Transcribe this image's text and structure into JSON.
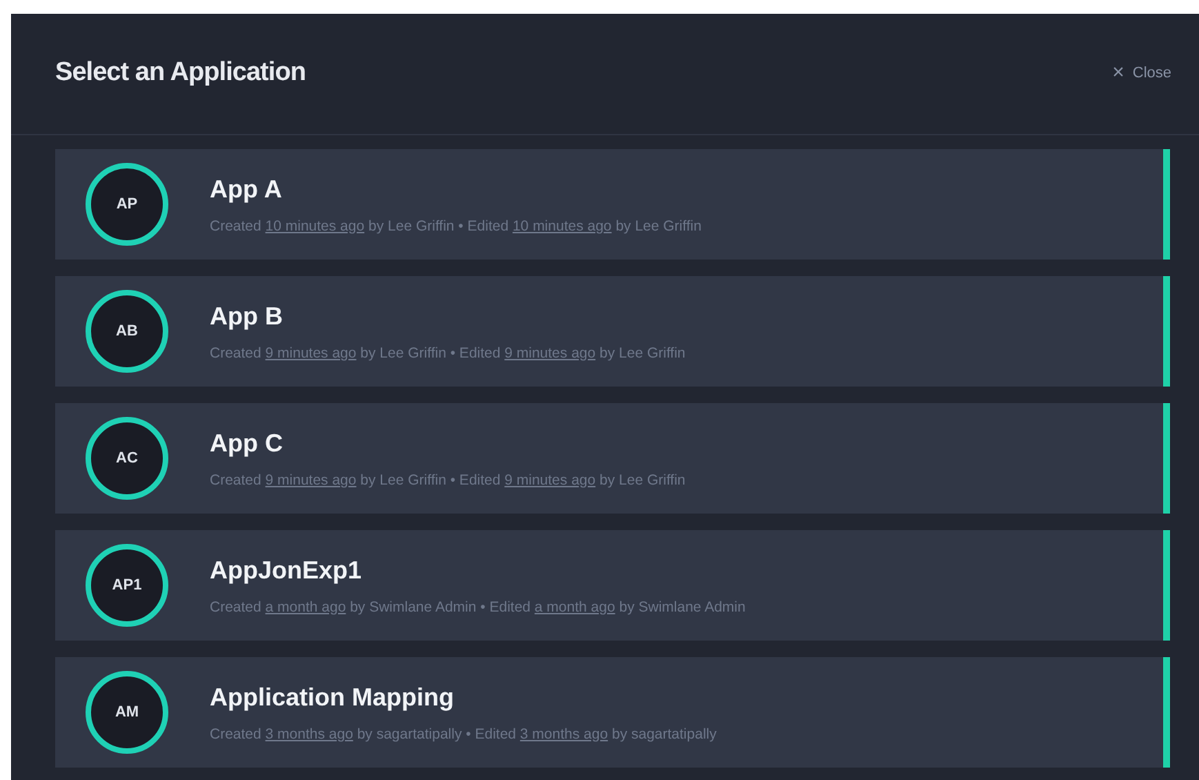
{
  "dialog": {
    "title": "Select an Application",
    "close": {
      "icon": "×",
      "label": "Close"
    }
  },
  "applications": [
    {
      "initials": "AP",
      "name": "App A",
      "meta": [
        {
          "kind": "plain",
          "text": "Created "
        },
        {
          "kind": "link",
          "text": "10 minutes ago"
        },
        {
          "kind": "plain",
          "text": " by Lee Griffin • Edited "
        },
        {
          "kind": "link",
          "text": "10 minutes ago"
        },
        {
          "kind": "plain",
          "text": " by Lee Griffin"
        }
      ]
    },
    {
      "initials": "AB",
      "name": "App B",
      "meta": [
        {
          "kind": "plain",
          "text": "Created "
        },
        {
          "kind": "link",
          "text": "9 minutes ago"
        },
        {
          "kind": "plain",
          "text": " by Lee Griffin • Edited "
        },
        {
          "kind": "link",
          "text": "9 minutes ago"
        },
        {
          "kind": "plain",
          "text": " by Lee Griffin"
        }
      ]
    },
    {
      "initials": "AC",
      "name": "App C",
      "meta": [
        {
          "kind": "plain",
          "text": "Created "
        },
        {
          "kind": "link",
          "text": "9 minutes ago"
        },
        {
          "kind": "plain",
          "text": " by Lee Griffin • Edited "
        },
        {
          "kind": "link",
          "text": "9 minutes ago"
        },
        {
          "kind": "plain",
          "text": " by Lee Griffin"
        }
      ]
    },
    {
      "initials": "AP1",
      "name": "AppJonExp1",
      "meta": [
        {
          "kind": "plain",
          "text": "Created "
        },
        {
          "kind": "link",
          "text": "a month ago"
        },
        {
          "kind": "plain",
          "text": " by Swimlane Admin • Edited "
        },
        {
          "kind": "link",
          "text": "a month ago"
        },
        {
          "kind": "plain",
          "text": " by Swimlane Admin"
        }
      ]
    },
    {
      "initials": "AM",
      "name": "Application Mapping",
      "meta": [
        {
          "kind": "plain",
          "text": "Created "
        },
        {
          "kind": "link",
          "text": "3 months ago"
        },
        {
          "kind": "plain",
          "text": " by sagartatipally • Edited "
        },
        {
          "kind": "link",
          "text": "3 months ago"
        },
        {
          "kind": "plain",
          "text": " by sagartatipally"
        }
      ]
    }
  ]
}
